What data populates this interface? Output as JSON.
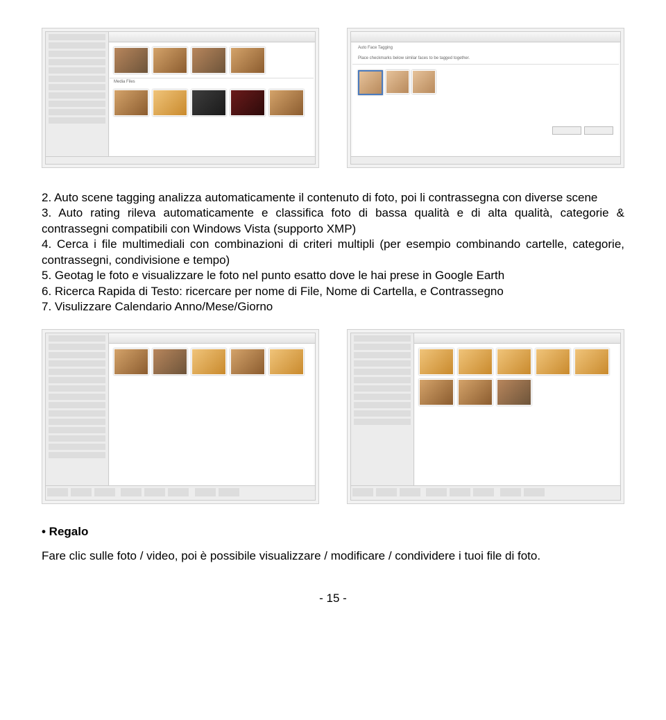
{
  "items": {
    "2": "2. Auto scene tagging analizza automaticamente il contenuto di foto, poi li contrassegna con diverse scene",
    "3": "3. Auto rating rileva automaticamente e classifica foto di bassa qualità e di alta qualità, categorie & contrassegni compatibili con Windows Vista (supporto XMP)",
    "4": "4. Cerca i file multimediali con combinazioni di criteri multipli (per esempio combinando cartelle, categorie, contrassegni, condivisione e tempo)",
    "5": "5. Geotag le foto e visualizzare le foto nel punto esatto dove le hai prese in Google Earth",
    "6": "6. Ricerca Rapida di Testo: ricercare per nome di File, Nome di Cartella, e Contrassegno",
    "7": "7. Visulizzare Calendario Anno/Mese/Giorno"
  },
  "section_heading": "• Regalo",
  "section_body": "Fare clic sulle foto / video, poi è possibile visualizzare / modificare / condividere i tuoi file di foto.",
  "page_number": "- 15 -"
}
